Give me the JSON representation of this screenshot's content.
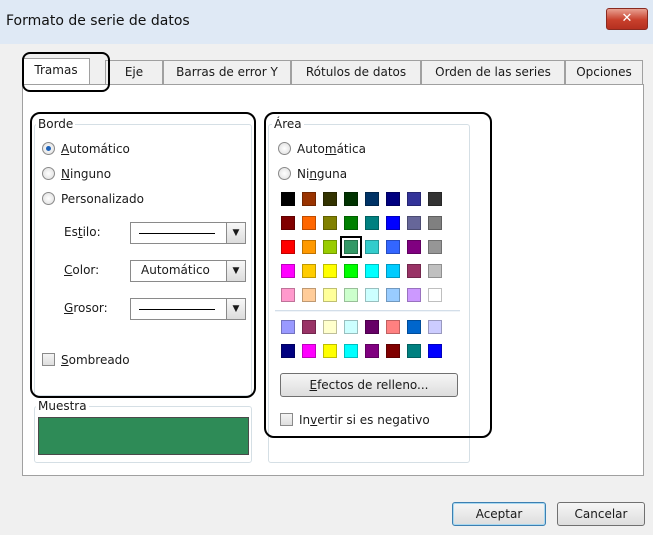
{
  "window": {
    "title": "Formato de serie de datos",
    "close_glyph": "✕"
  },
  "tabs": [
    {
      "label": "Tramas"
    },
    {
      "label": "Eje"
    },
    {
      "label": "Barras de error Y"
    },
    {
      "label": "Rótulos de datos"
    },
    {
      "label": "Orden de las series"
    },
    {
      "label": "Opciones"
    }
  ],
  "border_group": {
    "title": "Borde",
    "options": [
      {
        "pre": "",
        "key": "A",
        "post": "utomático",
        "selected": true
      },
      {
        "pre": "",
        "key": "N",
        "post": "inguno",
        "selected": false
      },
      {
        "pre": "Personalizado",
        "key": "",
        "post": "",
        "selected": false
      }
    ],
    "style": {
      "pre": "Es",
      "key": "t",
      "post": "ilo:"
    },
    "color": {
      "pre": "",
      "key": "C",
      "post": "olor:",
      "value": "Automático"
    },
    "weight": {
      "pre": "",
      "key": "G",
      "post": "rosor:"
    },
    "shadow": {
      "pre": "",
      "key": "S",
      "post": "ombreado",
      "checked": false
    }
  },
  "sample": {
    "title": "Muestra",
    "color": "#2e8b57"
  },
  "area_group": {
    "title": "Área",
    "options": [
      {
        "pre": "Auto",
        "key": "m",
        "post": "ática",
        "selected": false
      },
      {
        "pre": "Ni",
        "key": "n",
        "post": "guna",
        "selected": false
      }
    ],
    "palette_top": [
      [
        "#000000",
        "#993300",
        "#333300",
        "#003300",
        "#003366",
        "#000080",
        "#333399",
        "#333333"
      ],
      [
        "#800000",
        "#FF6600",
        "#808000",
        "#008000",
        "#008080",
        "#0000FF",
        "#666699",
        "#808080"
      ],
      [
        "#FF0000",
        "#FF9900",
        "#99CC00",
        "#339966",
        "#33CCCC",
        "#3366FF",
        "#800080",
        "#969696"
      ],
      [
        "#FF00FF",
        "#FFCC00",
        "#FFFF00",
        "#00FF00",
        "#00FFFF",
        "#00CCFF",
        "#993366",
        "#C0C0C0"
      ],
      [
        "#FF99CC",
        "#FFCC99",
        "#FFFF99",
        "#CCFFCC",
        "#CCFFFF",
        "#99CCFF",
        "#CC99FF",
        "#FFFFFF"
      ]
    ],
    "palette_bottom": [
      [
        "#9999FF",
        "#993366",
        "#FFFFCC",
        "#CCFFFF",
        "#660066",
        "#FF8080",
        "#0066CC",
        "#CCCCFF"
      ],
      [
        "#000080",
        "#FF00FF",
        "#FFFF00",
        "#00FFFF",
        "#800080",
        "#800000",
        "#008080",
        "#0000FF"
      ]
    ],
    "selected_swatch": "2,3",
    "fill_effects": {
      "pre": "",
      "key": "E",
      "post": "fectos de relleno..."
    },
    "invert": {
      "pre": "In",
      "key": "v",
      "post": "ertir si es negativo",
      "checked": false
    }
  },
  "footer": {
    "ok": "Aceptar",
    "cancel": "Cancelar"
  }
}
